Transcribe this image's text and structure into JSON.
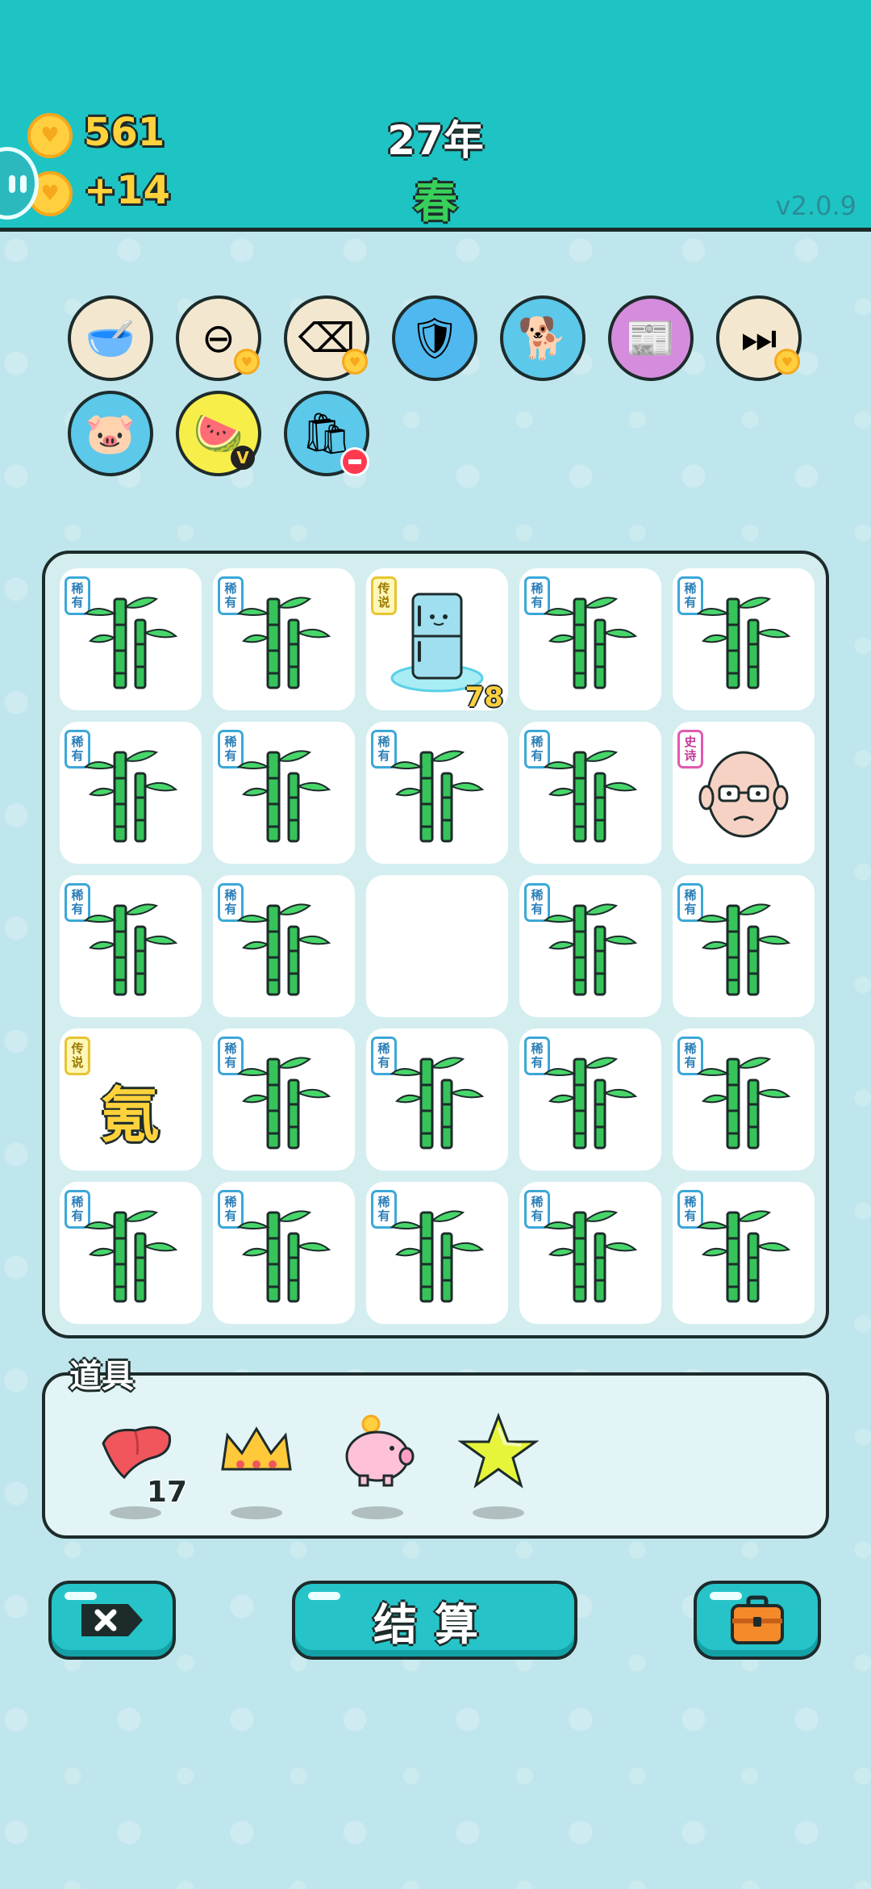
{
  "header": {
    "coins": "561",
    "coin_income": "+14",
    "year": "27年",
    "season": "春",
    "version": "v2.0.9"
  },
  "buffs": [
    {
      "name": "pet-food-bowl",
      "icon": "food-bowl-icon",
      "bg": "#f3e8cf",
      "glyph": "🥣",
      "badge": ""
    },
    {
      "name": "reduce-removal",
      "icon": "minus-circle-icon",
      "bg": "#f3e8cf",
      "glyph": "⊖",
      "badge": "heart"
    },
    {
      "name": "delete-removal",
      "icon": "delete-key-icon",
      "bg": "#f3e8cf",
      "glyph": "⌫",
      "badge": "heart"
    },
    {
      "name": "repair-shield",
      "icon": "shield-wrench-icon",
      "bg": "#4fb8ee",
      "glyph": "🛡",
      "badge": ""
    },
    {
      "name": "cool-dog",
      "icon": "dog-sunglasses-icon",
      "bg": "#5cc8ea",
      "glyph": "🐕",
      "badge": ""
    },
    {
      "name": "time-magazine",
      "icon": "time-magazine-icon",
      "bg": "#d58cdc",
      "glyph": "📰",
      "badge": ""
    },
    {
      "name": "skip",
      "icon": "skip-icon",
      "bg": "#f3e8cf",
      "glyph": "⏭",
      "badge": "heart"
    },
    {
      "name": "piggy-bank",
      "icon": "piggy-bank-icon",
      "bg": "#5cc8ea",
      "glyph": "🐷",
      "badge": ""
    },
    {
      "name": "fruit-basket",
      "icon": "fruit-basket-icon",
      "bg": "#f8ee4a",
      "glyph": "🍉",
      "badge": "v"
    },
    {
      "name": "garbage-bag",
      "icon": "trash-bag-icon",
      "bg": "#5cc8ea",
      "glyph": "🛍",
      "badge": "minus"
    }
  ],
  "board": {
    "tags": {
      "rare": "稀有",
      "legend": "传说",
      "epic": "史诗"
    },
    "cells": [
      {
        "kind": "bamboo",
        "tag": "rare"
      },
      {
        "kind": "bamboo",
        "tag": "rare"
      },
      {
        "kind": "fridge",
        "tag": "legend",
        "count": "78"
      },
      {
        "kind": "bamboo",
        "tag": "rare"
      },
      {
        "kind": "bamboo",
        "tag": "rare"
      },
      {
        "kind": "bamboo",
        "tag": "rare"
      },
      {
        "kind": "bamboo",
        "tag": "rare"
      },
      {
        "kind": "bamboo",
        "tag": "rare"
      },
      {
        "kind": "bamboo",
        "tag": "rare"
      },
      {
        "kind": "old-man",
        "tag": "epic"
      },
      {
        "kind": "bamboo",
        "tag": "rare"
      },
      {
        "kind": "bamboo",
        "tag": "rare"
      },
      {
        "kind": "empty",
        "tag": ""
      },
      {
        "kind": "bamboo",
        "tag": "rare"
      },
      {
        "kind": "bamboo",
        "tag": "rare"
      },
      {
        "kind": "krypton",
        "tag": "legend",
        "text": "氪"
      },
      {
        "kind": "bamboo",
        "tag": "rare"
      },
      {
        "kind": "bamboo",
        "tag": "rare"
      },
      {
        "kind": "bamboo",
        "tag": "rare"
      },
      {
        "kind": "bamboo",
        "tag": "rare"
      },
      {
        "kind": "bamboo",
        "tag": "rare"
      },
      {
        "kind": "bamboo",
        "tag": "rare"
      },
      {
        "kind": "bamboo",
        "tag": "rare"
      },
      {
        "kind": "bamboo",
        "tag": "rare"
      },
      {
        "kind": "bamboo",
        "tag": "rare"
      }
    ]
  },
  "props": {
    "title": "道具",
    "items": [
      {
        "name": "liver",
        "icon": "liver-icon",
        "count": "17"
      },
      {
        "name": "crown",
        "icon": "crown-icon",
        "count": ""
      },
      {
        "name": "piggy-bank",
        "icon": "piggy-bank-icon",
        "count": ""
      },
      {
        "name": "star",
        "icon": "star-icon",
        "count": ""
      }
    ]
  },
  "footer": {
    "remove_icon": "delete-key-icon",
    "settle_label": "结算",
    "bag_icon": "briefcase-icon"
  },
  "colors": {
    "topbar": "#1ec4c4",
    "background": "#bfe6ec",
    "coin": "#ffcf3f",
    "season": "#38d05a",
    "button": "#26c4c8"
  }
}
